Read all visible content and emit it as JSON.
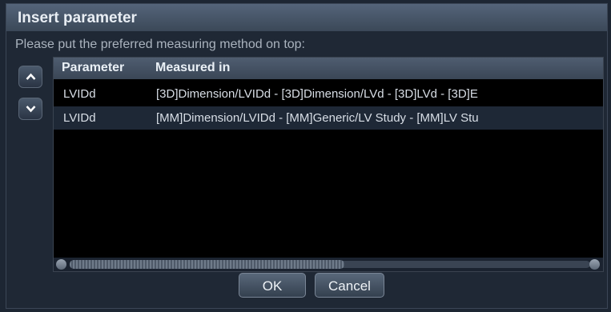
{
  "dialog": {
    "title": "Insert parameter",
    "prompt": "Please put the preferred measuring method on top:"
  },
  "table": {
    "columns": [
      "Parameter",
      "Measured in"
    ],
    "rows": [
      {
        "parameter": "LVIDd",
        "measured_in": "[3D]Dimension/LVIDd - [3D]Dimension/LVd - [3D]LVd - [3D]E"
      },
      {
        "parameter": "LVIDd",
        "measured_in": "[MM]Dimension/LVIDd - [MM]Generic/LV Study - [MM]LV Stu"
      }
    ]
  },
  "side_buttons": {
    "up": "chevron-up-icon",
    "down": "chevron-down-icon"
  },
  "buttons": {
    "ok": "OK",
    "cancel": "Cancel"
  }
}
